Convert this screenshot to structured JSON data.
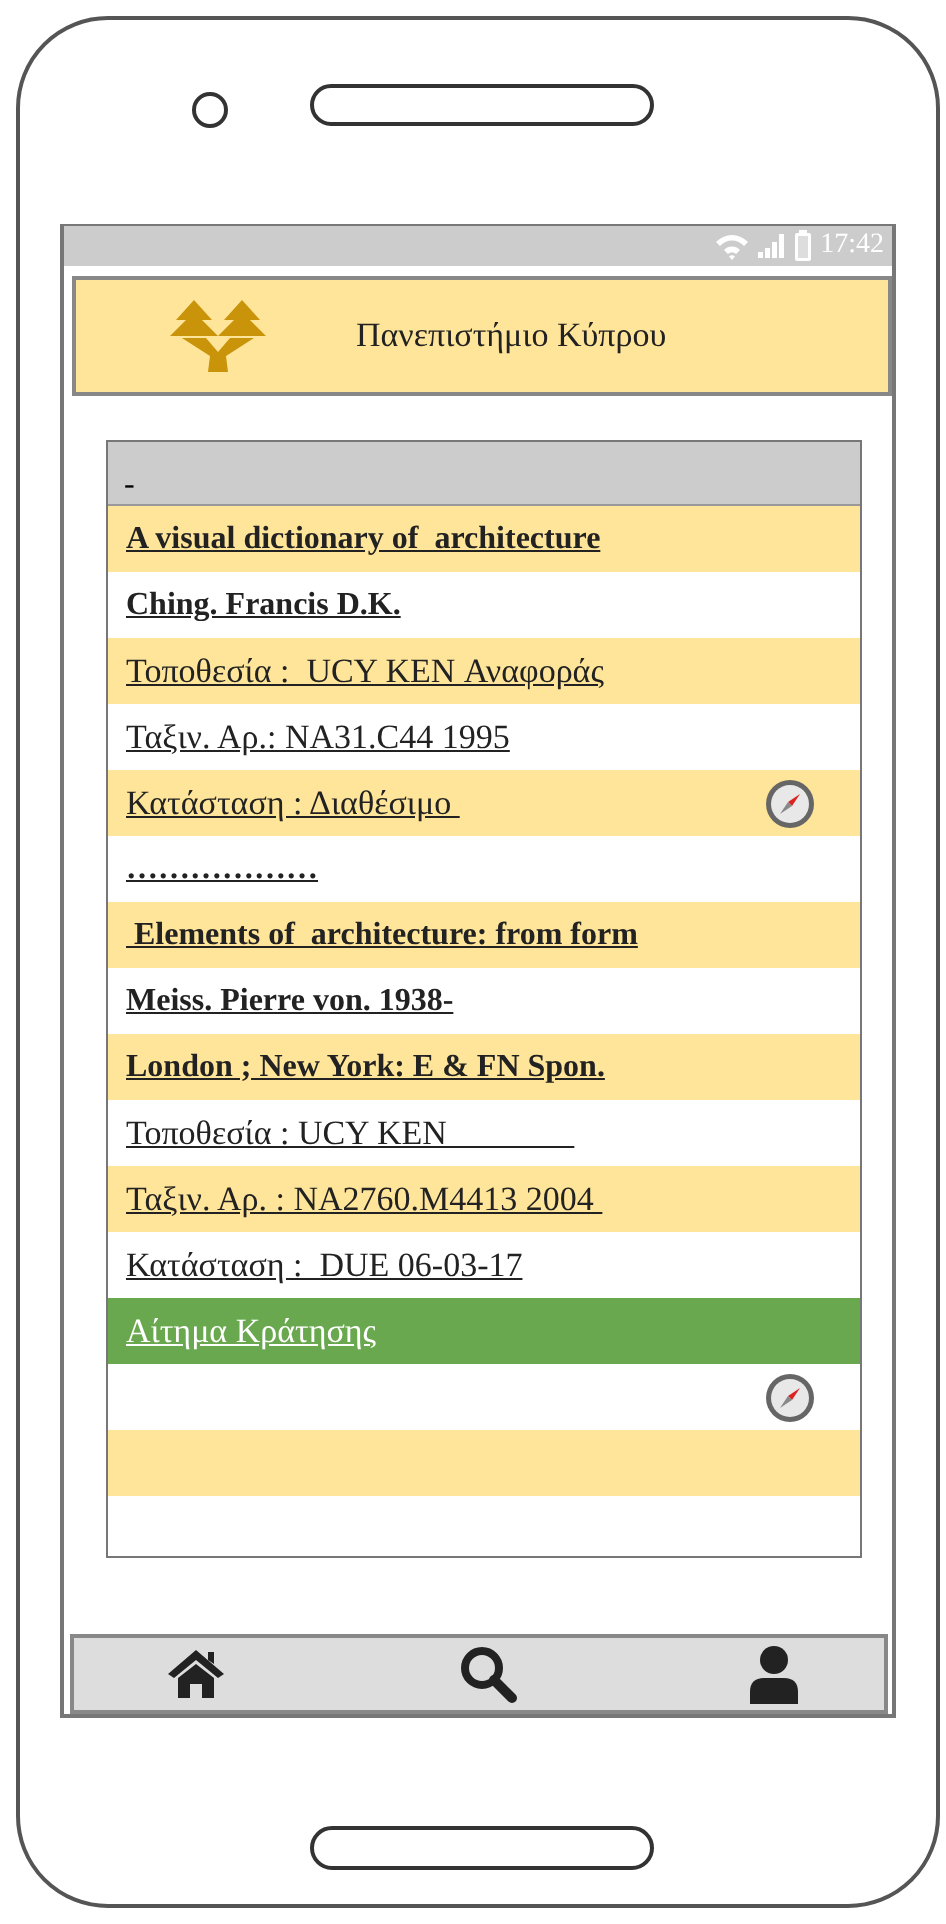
{
  "status_bar": {
    "time": "17:42"
  },
  "header": {
    "title": "Πανεπιστήμιο Κύπρου"
  },
  "list": {
    "header": "-",
    "rows": [
      {
        "kind": "heading",
        "text": "A visual dictionary of  architecture",
        "color": "#ffe599",
        "compass": false
      },
      {
        "kind": "heading",
        "text": "Ching. Francis D.K.",
        "color": "#ffffff",
        "compass": false
      },
      {
        "kind": "text",
        "text": "Τοποθεσία :  UCY KEN Αναφοράς",
        "color": "#ffe599",
        "compass": false
      },
      {
        "kind": "text",
        "text": "Ταξιν. Αρ.: NA31.C44 1995",
        "color": "#ffffff",
        "compass": false
      },
      {
        "kind": "text",
        "text": "Κατάσταση : Διαθέσιμο ",
        "color": "#ffe599",
        "compass": true
      },
      {
        "kind": "heading",
        "text": "………………",
        "color": "#ffffff",
        "compass": false
      },
      {
        "kind": "heading",
        "text": " Elements of  architecture: from form",
        "color": "#ffe599",
        "compass": false
      },
      {
        "kind": "heading",
        "text": "Meiss. Pierre von. 1938-",
        "color": "#ffffff",
        "compass": false
      },
      {
        "kind": "heading",
        "text": "London ; New York: E & FN Spon.",
        "color": "#ffe599",
        "compass": false
      },
      {
        "kind": "text",
        "text": "Τοποθεσία : UCY KEN               ",
        "color": "#ffffff",
        "compass": false
      },
      {
        "kind": "text",
        "text": "Ταξιν. Αρ. : NA2760.M4413 2004 ",
        "color": "#ffe599",
        "compass": false
      },
      {
        "kind": "text",
        "text": "Κατάσταση :  DUE 06-03-17",
        "color": "#ffffff",
        "compass": false
      },
      {
        "kind": "action",
        "text": "Αίτημα Κράτησης",
        "color": "#6aa84f",
        "compass": false
      },
      {
        "kind": "blank",
        "color": "#ffffff",
        "compass": true
      },
      {
        "kind": "blank",
        "color": "#ffe599",
        "compass": false
      }
    ]
  }
}
